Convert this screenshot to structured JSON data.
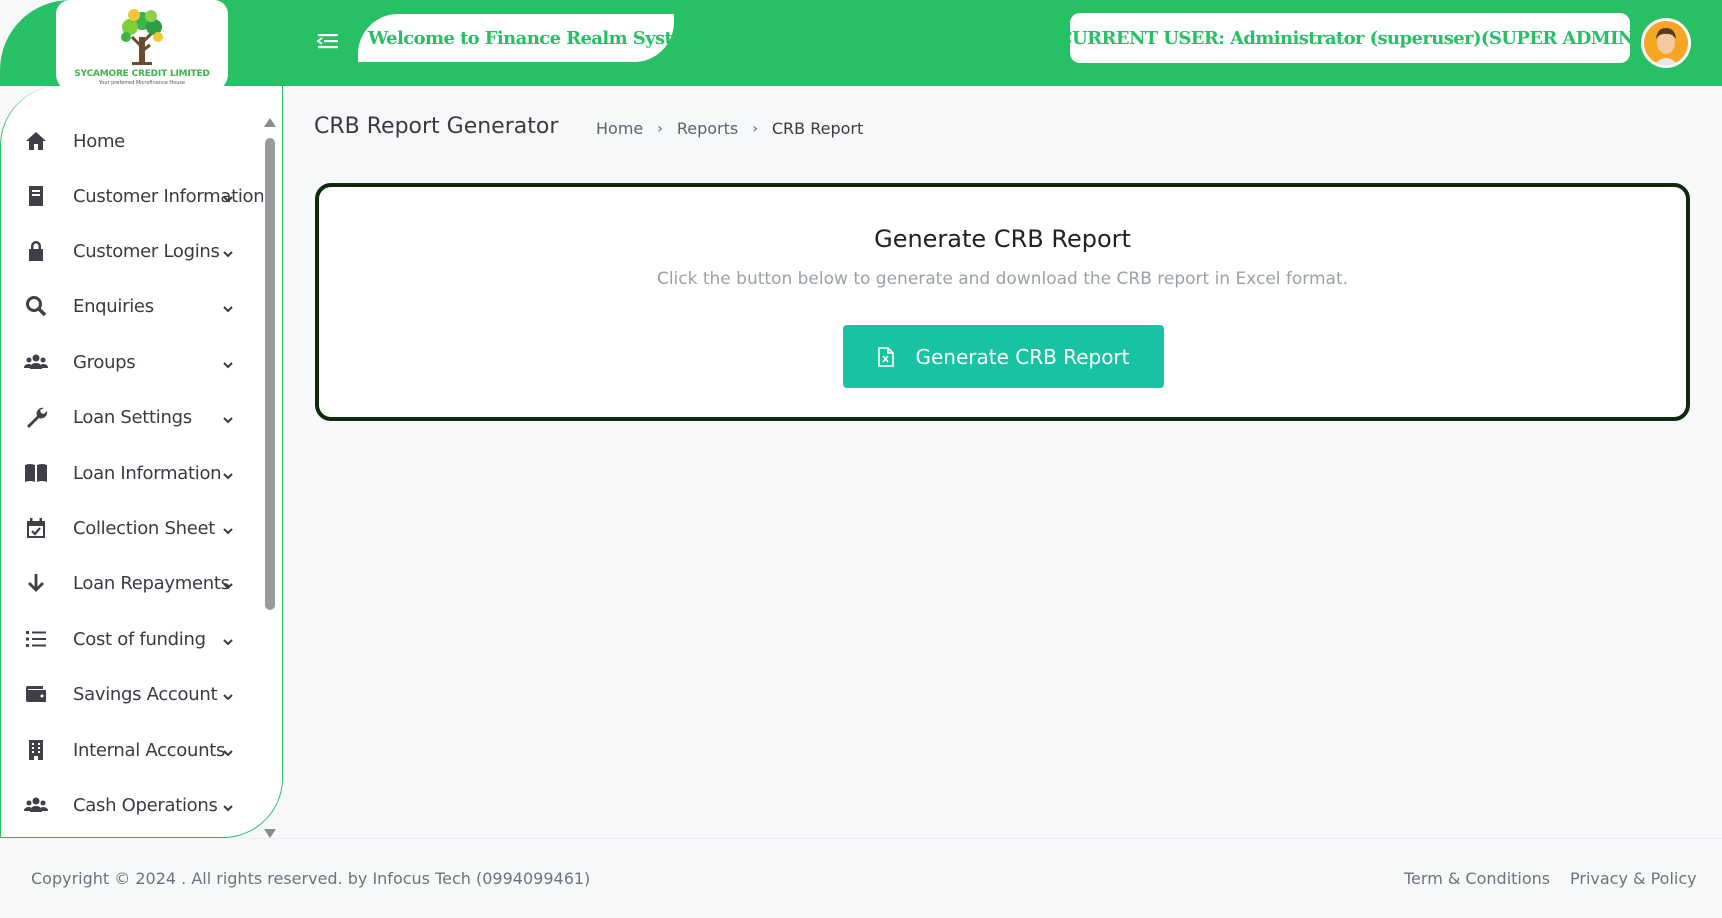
{
  "header": {
    "logo_company": "SYCAMORE CREDIT LIMITED",
    "logo_tagline": "Your preferred Microfinance House",
    "welcome_text": "Welcome to Finance Realm System",
    "current_user_text": "CURRENT USER: Administrator (superuser)(SUPER ADMIN)",
    "menu_icon": "hamburger-menu-icon",
    "brand_color": "#27c065"
  },
  "sidebar": {
    "items": [
      {
        "label": "Home",
        "icon": "home-icon"
      },
      {
        "label": "Customer Information",
        "icon": "book-icon"
      },
      {
        "label": "Customer Logins",
        "icon": "lock-icon"
      },
      {
        "label": "Enquiries",
        "icon": "search-icon"
      },
      {
        "label": "Groups",
        "icon": "users-icon"
      },
      {
        "label": "Loan Settings",
        "icon": "wrench-icon"
      },
      {
        "label": "Loan Information",
        "icon": "open-book-icon"
      },
      {
        "label": "Collection Sheet",
        "icon": "calendar-check-icon"
      },
      {
        "label": "Loan Repayments",
        "icon": "arrow-down-icon"
      },
      {
        "label": "Cost of funding",
        "icon": "list-icon"
      },
      {
        "label": "Savings Account",
        "icon": "wallet-icon"
      },
      {
        "label": "Internal Accounts",
        "icon": "building-icon"
      },
      {
        "label": "Cash Operations",
        "icon": "users-icon"
      }
    ]
  },
  "main": {
    "page_title": "CRB Report Generator",
    "breadcrumb": [
      "Home",
      "Reports",
      "CRB Report"
    ],
    "card": {
      "title": "Generate CRB Report",
      "description": "Click the button below to generate and download the CRB report in Excel format.",
      "button_label": "Generate CRB Report",
      "button_color": "#17c3a3"
    }
  },
  "footer": {
    "copyright": "Copyright © 2024 . All rights reserved. by Infocus Tech (0994099461)",
    "links": [
      "Term & Conditions",
      "Privacy & Policy"
    ]
  }
}
